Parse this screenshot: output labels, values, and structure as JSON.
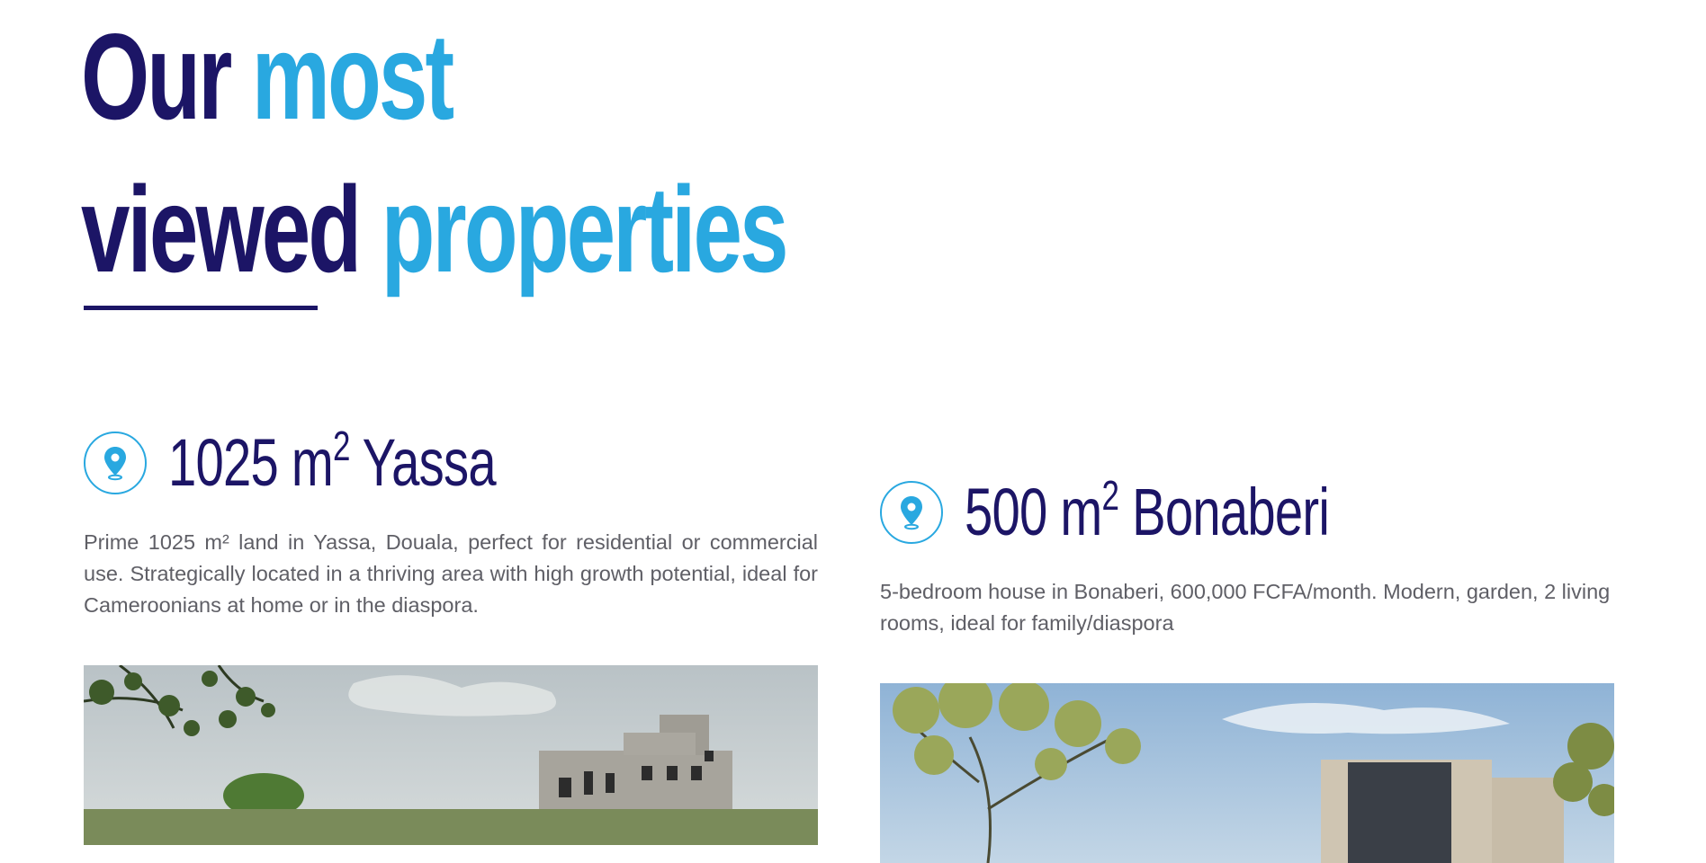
{
  "heading": {
    "line1_part1": "Our",
    "line1_part2": "most",
    "line2_part1": "viewed",
    "line2_part2": "properties"
  },
  "colors": {
    "primary": "#1c1566",
    "accent": "#29a8e0",
    "body_text": "#5f5f66"
  },
  "properties": [
    {
      "title_number": "1025 m",
      "title_sup": "2",
      "title_place": " Yassa",
      "icon": "map-pin-icon",
      "description": "Prime 1025 m² land in Yassa, Douala, perfect for residential or commercial use. Strategically located in a thriving area with high growth potential, ideal for Cameroonians at home or in the diaspora."
    },
    {
      "title_number": "500 m",
      "title_sup": "2",
      "title_place": " Bonaberi",
      "icon": "map-pin-icon",
      "description": "5-bedroom house in Bonaberi, 600,000 FCFA/month. Modern, garden, 2 living rooms, ideal for family/diaspora"
    }
  ]
}
